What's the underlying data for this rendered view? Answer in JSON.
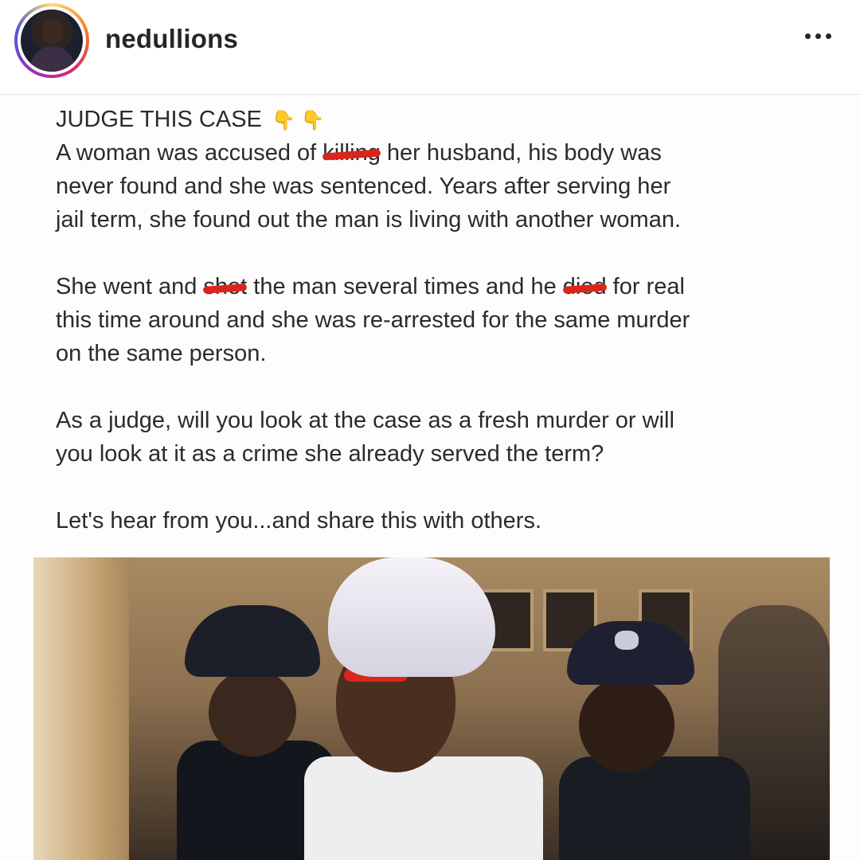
{
  "header": {
    "username": "nedullions",
    "more_icon": "more-horizontal-icon"
  },
  "post": {
    "title": "JUDGE THIS CASE",
    "title_emoji": "👇 👇",
    "paragraphs": [
      {
        "lines": [
          [
            "A woman was accused of ",
            "killing",
            " her husband, his body was"
          ],
          [
            "never found and she was sentenced. Years after serving her"
          ],
          [
            "jail term, she found out the man is living with another woman."
          ]
        ]
      },
      {
        "lines": [
          [
            "She went and ",
            "shot",
            " the man several times and he ",
            "died",
            " for real"
          ],
          [
            "this time around and she was re-arrested for the same murder"
          ],
          [
            "on the same person."
          ]
        ]
      },
      {
        "lines": [
          [
            "As a judge, will you look at the case as a fresh murder or will"
          ],
          [
            "you look at it as a crime she already served the term?"
          ]
        ]
      },
      {
        "lines": [
          [
            "Let's hear from you...and share this with others."
          ]
        ]
      }
    ]
  },
  "colors": {
    "redaction": "#d9251c",
    "text": "#2b2b2b",
    "username": "#262626"
  }
}
